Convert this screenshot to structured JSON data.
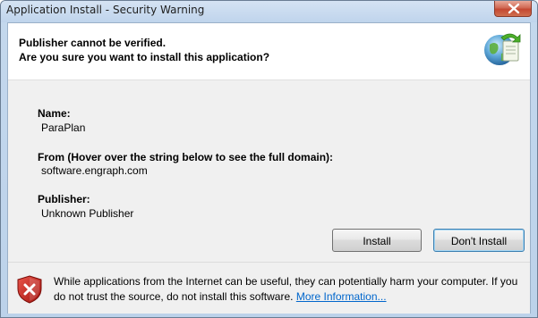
{
  "window": {
    "title": "Application Install - Security Warning"
  },
  "header": {
    "line1": "Publisher cannot be verified.",
    "line2": "Are you sure you want to install this application?",
    "icon": "globe-install-icon"
  },
  "fields": {
    "name_label": "Name:",
    "name_value": "ParaPlan",
    "from_label": "From (Hover over the string below to see the full domain):",
    "from_value": "software.engraph.com",
    "publisher_label": "Publisher:",
    "publisher_value": "Unknown Publisher"
  },
  "buttons": {
    "install_label": "Install",
    "dont_install_label": "Don't Install"
  },
  "warning": {
    "text": "While applications from the Internet can be useful, they can potentially harm your computer. If you do not trust the source, do not install this software.",
    "link_label": "More Information...",
    "icon": "shield-warning-icon"
  },
  "colors": {
    "link": "#0066cc",
    "shield_red": "#c8211c",
    "close_button": "#c44832"
  }
}
